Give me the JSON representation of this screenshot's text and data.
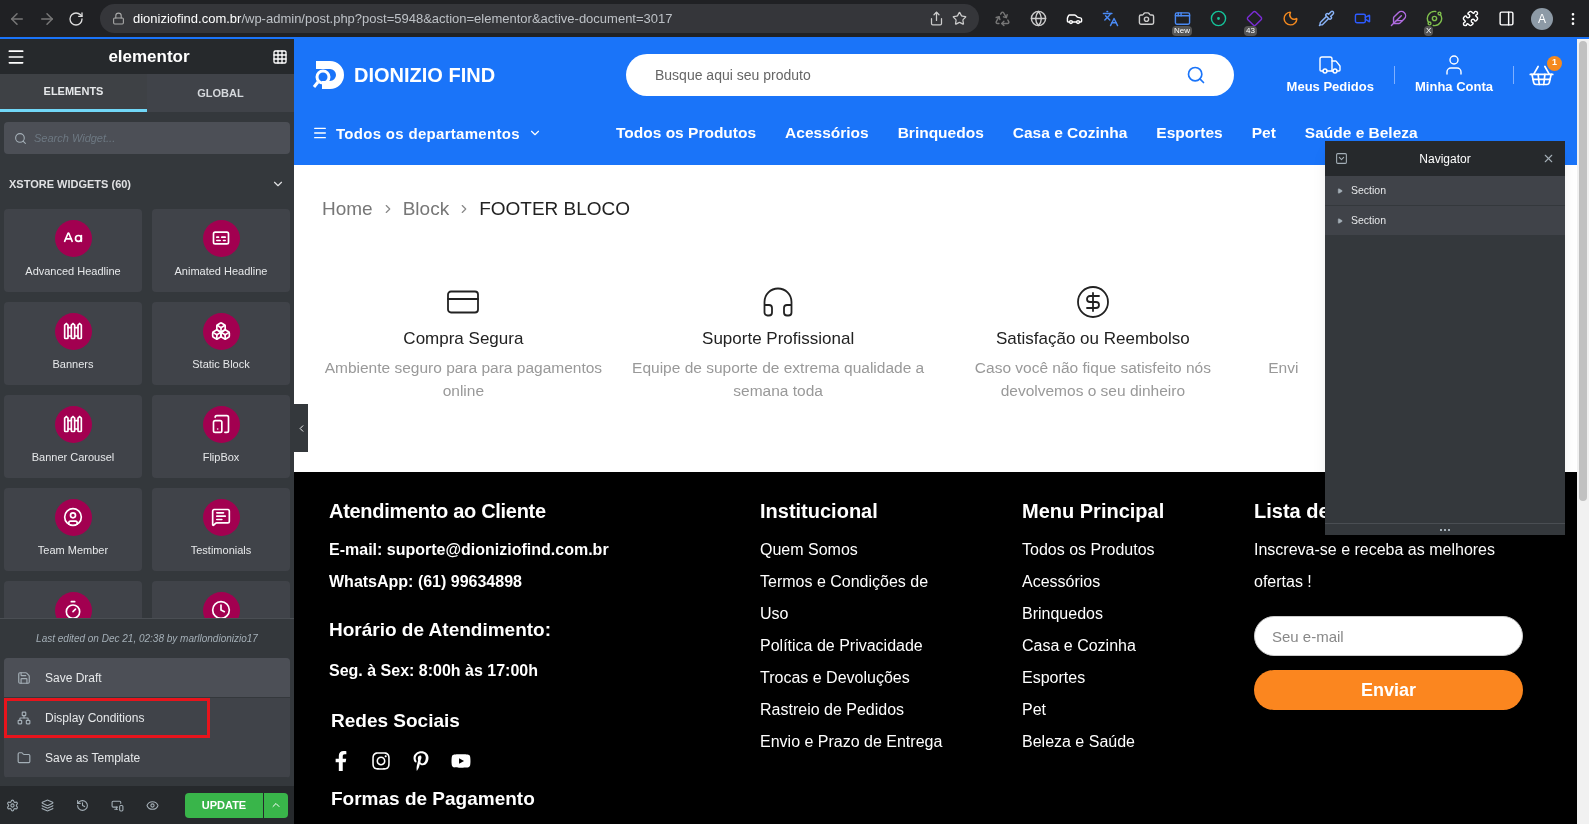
{
  "browser": {
    "url_host": "dioniziofind.com.br",
    "url_path": "/wp-admin/post.php?post=5948&action=elementor&active-document=3017",
    "extension_badges": [
      "New",
      "43",
      "X"
    ],
    "avatar": "A"
  },
  "editor": {
    "logo": "elementor",
    "tabs": [
      {
        "label": "ELEMENTS",
        "selected": true
      },
      {
        "label": "GLOBAL",
        "selected": false
      }
    ],
    "search": {
      "placeholder": "Search Widget..."
    },
    "category": {
      "title": "XSTORE WIDGETS (60)",
      "expanded": true
    },
    "widgets": [
      "Advanced Headline",
      "Animated Headline",
      "Banners",
      "Static Block",
      "Banner Carousel",
      "FlipBox",
      "Team Member",
      "Testimonials"
    ],
    "last_edited": "Last edited on Dec 21, 02:38 by marllondionizio17",
    "actions": [
      {
        "label": "Save Draft",
        "highlighted": false
      },
      {
        "label": "Display Conditions",
        "highlighted": true
      },
      {
        "label": "Save as Template",
        "highlighted": false
      }
    ],
    "update_button": "UPDATE"
  },
  "site": {
    "logo": "DIONIZIO FIND",
    "search": {
      "placeholder": "Busque aqui seu produto"
    },
    "header_links": [
      "Meus Pedidos",
      "Minha Conta"
    ],
    "cart_count": "1",
    "departments": "Todos os departamentos",
    "nav": [
      "Todos os Produtos",
      "Acessórios",
      "Brinquedos",
      "Casa e Cozinha",
      "Esportes",
      "Pet",
      "Saúde e Beleza"
    ],
    "breadcrumb": [
      {
        "label": "Home",
        "current": false
      },
      {
        "label": "Block",
        "current": false
      },
      {
        "label": "FOOTER BLOCO",
        "current": true
      }
    ],
    "features": [
      {
        "title": "Compra Segura",
        "description": "Ambiente seguro para para pagamentos online"
      },
      {
        "title": "Suporte Profissional",
        "description": "Equipe de suporte de extrema qualidade a semana toda"
      },
      {
        "title": "Satisfação ou Reembolso",
        "description": "Caso você não fique satisfeito nós devolvemos o seu dinheiro"
      },
      {
        "description": "Envi"
      }
    ],
    "footer": {
      "contact": {
        "title": "Atendimento ao Cliente",
        "email": "E-mail: suporte@dioniziofind.com.br",
        "whatsapp": "WhatsApp: (61) 99634898",
        "hours_title": "Horário de Atendimento:",
        "hours": "Seg. à Sex: 8:00h às 17:00h",
        "social_title": "Redes Sociais",
        "payment_title": "Formas de Pagamento"
      },
      "columns": [
        {
          "title": "Institucional",
          "links": [
            "Quem Somos",
            "Termos e Condições de Uso",
            "Política de Privacidade",
            "Trocas e Devoluções",
            "Rastreio de Pedidos",
            "Envio e Prazo de Entrega"
          ]
        },
        {
          "title": "Menu Principal",
          "links": [
            "Todos os Produtos",
            "Acessórios",
            "Brinquedos",
            "Casa e Cozinha",
            "Esportes",
            "Pet",
            "Beleza e Saúde"
          ]
        }
      ],
      "newsletter": {
        "title": "Lista de",
        "text": "Inscreva-se e receba as melhores ofertas !",
        "placeholder": "Seu e-mail",
        "button": "Enviar"
      }
    }
  },
  "navigator": {
    "title": "Navigator",
    "items": [
      {
        "label": "Section",
        "expanded": false
      },
      {
        "label": "Section",
        "expanded": false
      }
    ]
  }
}
